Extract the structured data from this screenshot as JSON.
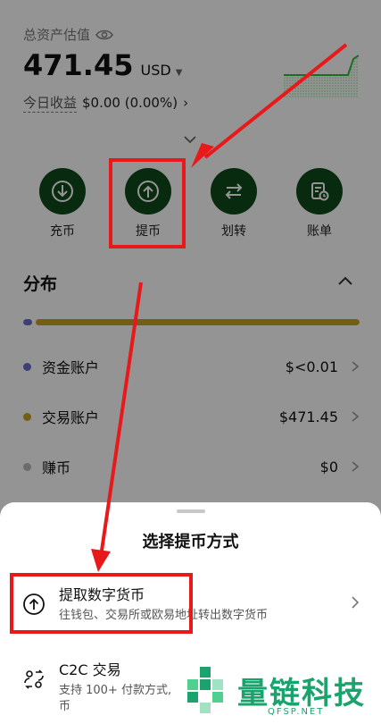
{
  "assets": {
    "label": "总资产估值",
    "value": "471.45",
    "unit": "USD",
    "today_label": "今日收益",
    "today_value": "$0.00 (0.00%)",
    "today_arrow": "›"
  },
  "actions": [
    {
      "label": "充币",
      "icon": "deposit-icon"
    },
    {
      "label": "提币",
      "icon": "withdraw-icon"
    },
    {
      "label": "划转",
      "icon": "transfer-icon"
    },
    {
      "label": "账单",
      "icon": "bill-icon"
    }
  ],
  "distribution": {
    "title": "分布",
    "accounts": [
      {
        "name": "资金账户",
        "value": "$<0.01",
        "color": "#6a6fc8"
      },
      {
        "name": "交易账户",
        "value": "$471.45",
        "color": "#c9a227"
      },
      {
        "name": "赚币",
        "value": "$0",
        "color": "#b8b8b8"
      }
    ],
    "bar_colors": {
      "funding": "#6a6fc8",
      "trading": "#c9a227"
    },
    "funding_share": 0.0,
    "trading_share": 1.0
  },
  "sheet": {
    "title": "选择提币方式",
    "options": [
      {
        "title": "提取数字货币",
        "subtitle": "往钱包、交易所或欧易地址转出数字货币",
        "icon": "upload-circle-icon"
      },
      {
        "title": "C2C 交易",
        "subtitle": "支持 100+ 付款方式,",
        "subtitle2": "币",
        "icon": "c2c-icon"
      }
    ]
  },
  "watermark": {
    "text": "量链科技",
    "sub": "QFSP.NET"
  },
  "colors": {
    "brand_green": "#0f4a1c",
    "annotation_red": "#e8191a",
    "watermark_green": "#1aa36c"
  }
}
